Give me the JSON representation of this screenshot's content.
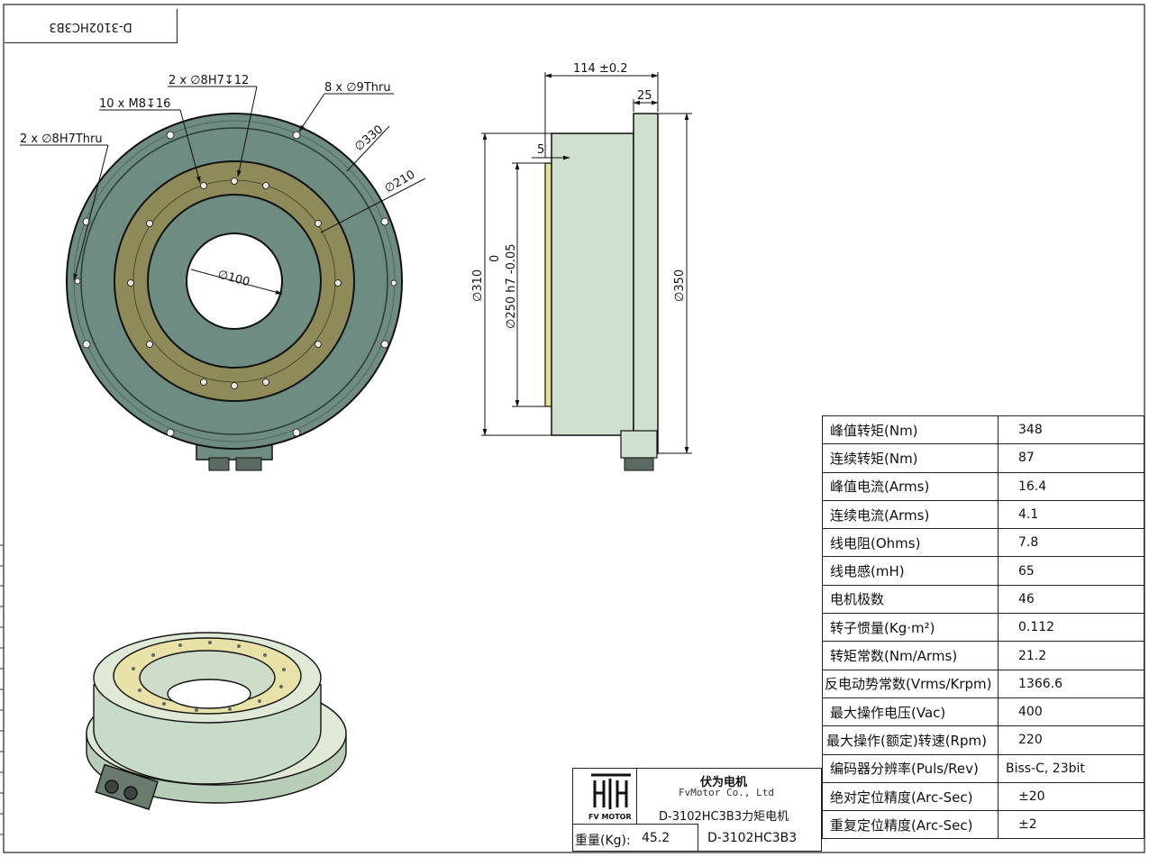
{
  "drawing_code_mirrored": "D-3102HC3B3",
  "front_view": {
    "callouts": {
      "blind_pins": "2 x ∅8H7↧12",
      "tapped_holes": "10 x M8↧16",
      "mount_holes": "8 x ∅9Thru",
      "thru_pins": "2 x ∅8H7Thru",
      "dia_330": "∅330",
      "dia_210": "∅210",
      "dia_100": "∅100"
    }
  },
  "side_view": {
    "length": "114 ±0.2",
    "flange": "25",
    "pilot": "5",
    "dia_310": "∅310",
    "dia_250": "∅250 h7 -0.05",
    "dia_250_upper": "0",
    "dia_350": "∅350"
  },
  "specs": [
    {
      "label": "峰值转矩(Nm)",
      "value": "348"
    },
    {
      "label": "连续转矩(Nm)",
      "value": "87"
    },
    {
      "label": "峰值电流(Arms)",
      "value": "16.4"
    },
    {
      "label": "连续电流(Arms)",
      "value": "4.1"
    },
    {
      "label": "线电阻(Ohms)",
      "value": "7.8"
    },
    {
      "label": "线电感(mH)",
      "value": "65"
    },
    {
      "label": "电机极数",
      "value": "46"
    },
    {
      "label": "转子惯量(Kg·m²)",
      "value": "0.112"
    },
    {
      "label": "转矩常数(Nm/Arms)",
      "value": "21.2"
    },
    {
      "label": "反电动势常数(Vrms/Krpm)",
      "value": "1366.6"
    },
    {
      "label": "最大操作电压(Vac)",
      "value": "400"
    },
    {
      "label": "最大操作(额定)转速(Rpm)",
      "value": "220"
    },
    {
      "label": "编码器分辨率(Puls/Rev)",
      "value": "Biss-C, 23bit"
    },
    {
      "label": "绝对定位精度(Arc-Sec)",
      "value": "±20"
    },
    {
      "label": "重复定位精度(Arc-Sec)",
      "value": "±2"
    }
  ],
  "title_block": {
    "company_cn": "伏为电机",
    "company_en": "FvMotor Co., Ltd",
    "product": "D-3102HC3B3力矩电机",
    "logo_text": "FV MOTOR",
    "weight_label": "重量(Kg):",
    "weight_value": "45.2",
    "model": "D-3102HC3B3"
  },
  "colors": {
    "housing": "#6f8c83",
    "rotor_ring": "#8e8a5a",
    "flange_green": "#cfe0cf",
    "iso_top": "#dfe9d6",
    "iso_ring": "#e9e2a8"
  }
}
